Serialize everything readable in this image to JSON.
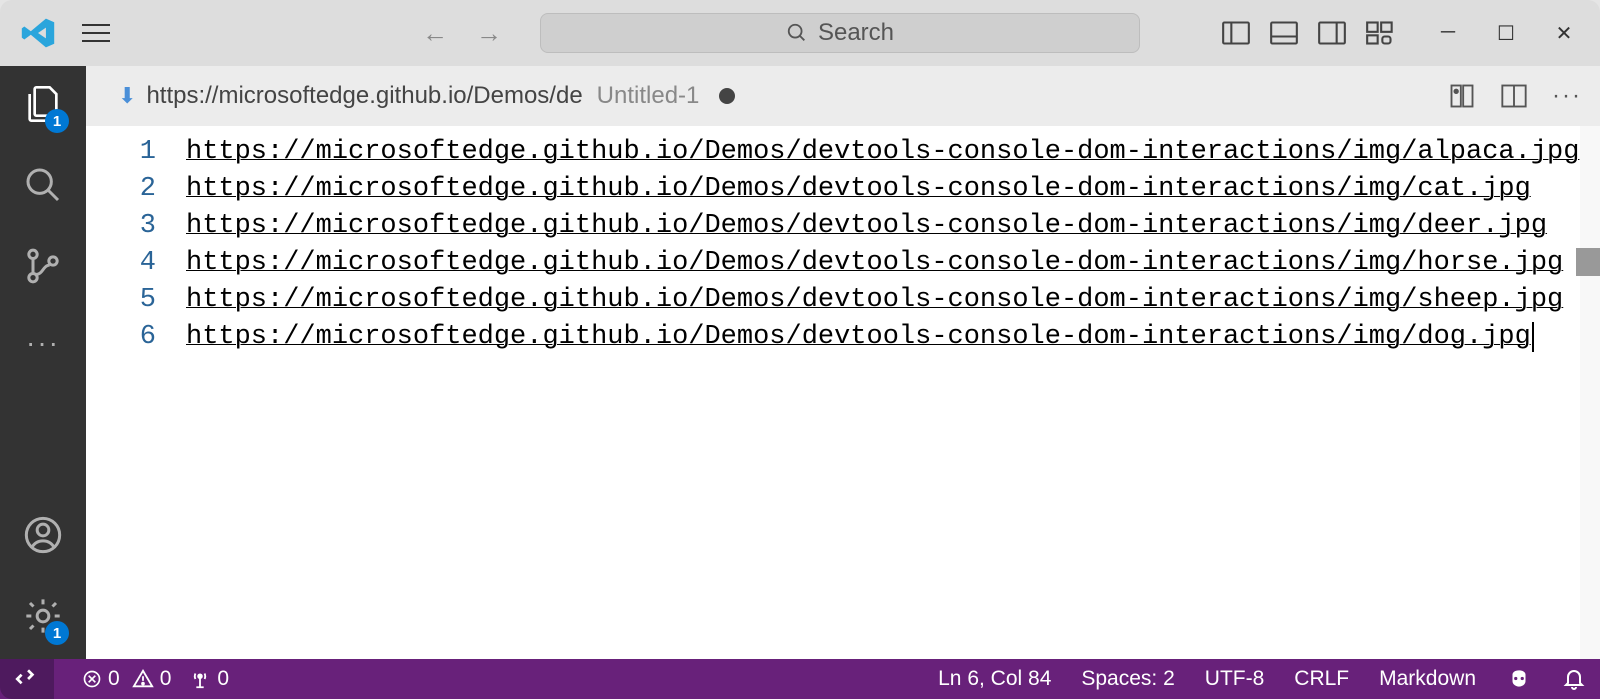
{
  "titlebar": {
    "search_placeholder": "Search"
  },
  "activity": {
    "explorer_badge": "1",
    "settings_badge": "1"
  },
  "tab": {
    "title": "https://microsoftedge.github.io/Demos/de",
    "suffix": "Untitled-1"
  },
  "editor": {
    "lines": [
      "https://microsoftedge.github.io/Demos/devtools-console-dom-interactions/img/alpaca.jpg",
      "https://microsoftedge.github.io/Demos/devtools-console-dom-interactions/img/cat.jpg",
      "https://microsoftedge.github.io/Demos/devtools-console-dom-interactions/img/deer.jpg",
      "https://microsoftedge.github.io/Demos/devtools-console-dom-interactions/img/horse.jpg",
      "https://microsoftedge.github.io/Demos/devtools-console-dom-interactions/img/sheep.jpg",
      "https://microsoftedge.github.io/Demos/devtools-console-dom-interactions/img/dog.jpg"
    ],
    "line_numbers": [
      "1",
      "2",
      "3",
      "4",
      "5",
      "6"
    ]
  },
  "status": {
    "errors": "0",
    "warnings": "0",
    "ports": "0",
    "cursor": "Ln 6, Col 84",
    "spaces": "Spaces: 2",
    "encoding": "UTF-8",
    "eol": "CRLF",
    "language": "Markdown"
  }
}
